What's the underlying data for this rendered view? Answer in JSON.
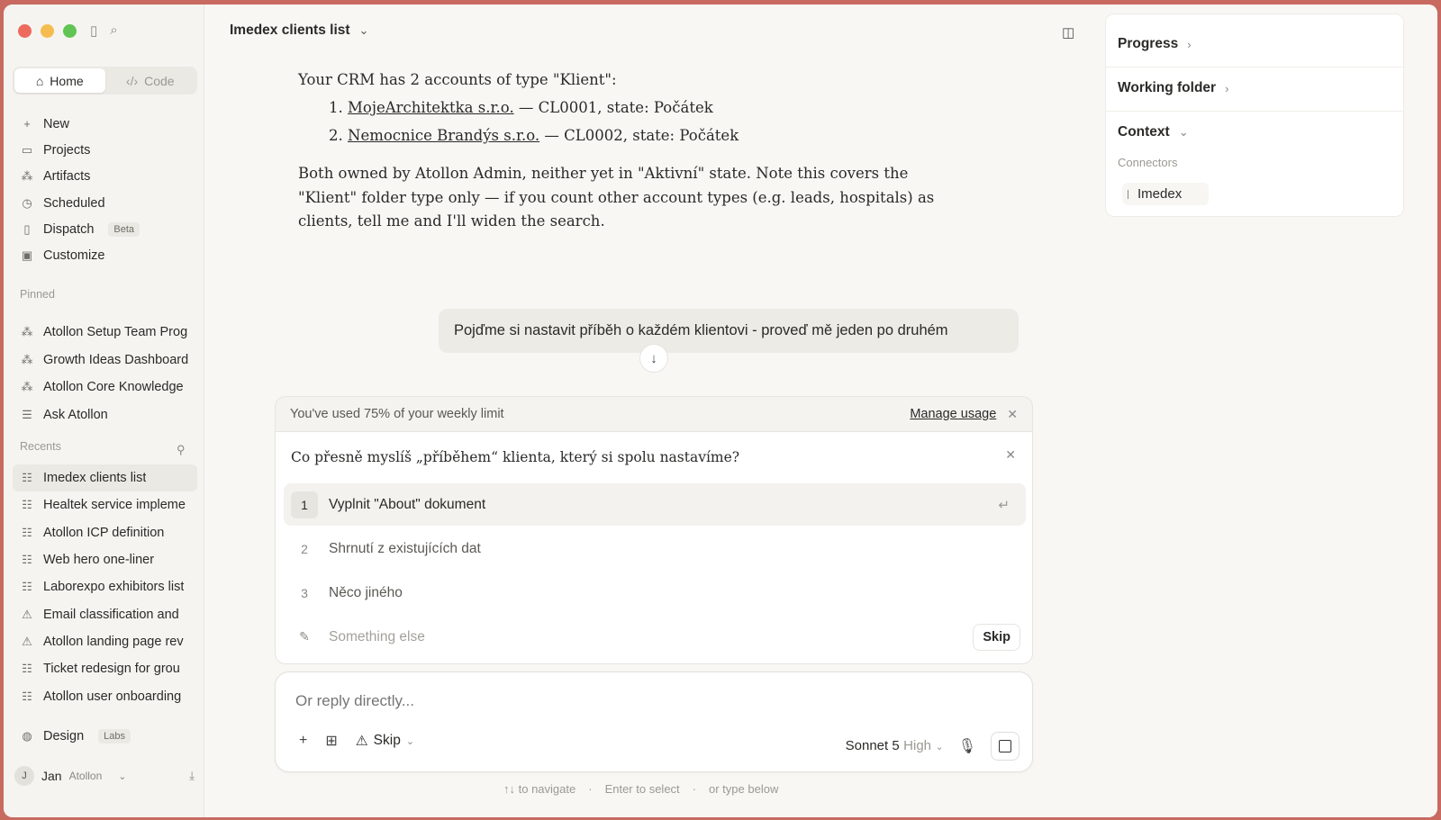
{
  "sidebar": {
    "mode_tabs": [
      "Home",
      "Code"
    ],
    "nav": [
      {
        "label": "New",
        "icon": "plus-icon"
      },
      {
        "label": "Projects",
        "icon": "folder-icon"
      },
      {
        "label": "Artifacts",
        "icon": "artifacts-icon"
      },
      {
        "label": "Scheduled",
        "icon": "clock-icon"
      },
      {
        "label": "Dispatch",
        "icon": "phone-icon",
        "badge": "Beta"
      },
      {
        "label": "Customize",
        "icon": "briefcase-icon"
      }
    ],
    "pinned_label": "Pinned",
    "pinned": [
      "Atollon Setup Team Prog",
      "Growth Ideas Dashboard",
      "Atollon Core Knowledge",
      "Ask Atollon"
    ],
    "recents_label": "Recents",
    "recents": [
      "Imedex clients list",
      "Healtek service impleme",
      "Atollon ICP definition",
      "Web hero one-liner",
      "Laborexpo exhibitors list",
      "Email classification and",
      "Atollon landing page rev",
      "Ticket redesign for grou",
      "Atollon user onboarding"
    ],
    "design_label": "Design",
    "labs_badge": "Labs",
    "user": {
      "initial": "J",
      "name": "Jan",
      "org": "Atollon"
    }
  },
  "main": {
    "chat_title": "Imedex clients list",
    "answer": {
      "intro": "Your CRM has 2 accounts of type \"Klient\":",
      "items": [
        {
          "num": "1.",
          "name": "MojeArchitektka s.r.o.",
          "rest": " — CL0001, state: Počátek"
        },
        {
          "num": "2.",
          "name": "Nemocnice Brandýs s.r.o.",
          "rest": " — CL0002, state: Počátek"
        }
      ],
      "outro": "Both owned by Atollon Admin, neither yet in \"Aktivní\" state. Note this covers the \"Klient\" folder type only — if you count other account types (e.g. leads, hospitals) as clients, tell me and I'll widen the search."
    },
    "user_message": "Pojďme si nastavit příběh o každém klientovi - proveď mě jeden po druhém",
    "usage": {
      "text": "You've used 75% of your weekly limit",
      "manage": "Manage usage"
    },
    "question": {
      "text": "Co přesně myslíš „příběhem“ klienta, který si spolu nastavíme?",
      "options": [
        {
          "num": "1",
          "label": "Vyplnit \"About\" dokument"
        },
        {
          "num": "2",
          "label": "Shrnutí z existujících dat"
        },
        {
          "num": "3",
          "label": "Něco jiného"
        }
      ],
      "other_placeholder": "Something else",
      "skip": "Skip"
    },
    "reply": {
      "placeholder": "Or reply directly...",
      "skip_label": "Skip",
      "model": "Sonnet 5",
      "effort": "High"
    },
    "hints": [
      "↑↓ to navigate",
      "·",
      "Enter to select",
      "·",
      "or type below"
    ]
  },
  "right_panel": {
    "progress": "Progress",
    "working_folder": "Working folder",
    "context": "Context",
    "connectors_label": "Connectors",
    "connector": "Imedex"
  }
}
